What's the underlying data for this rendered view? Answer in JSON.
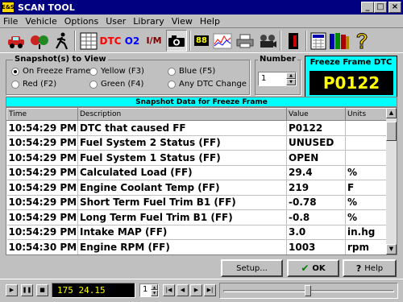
{
  "app": {
    "icon_text": "E&S",
    "title": "SCAN TOOL"
  },
  "window_buttons": {
    "minimize": "_",
    "maximize": "□",
    "close": "×"
  },
  "menu": [
    "File",
    "Vehicle",
    "Options",
    "User",
    "Library",
    "View",
    "Help"
  ],
  "toolbar": {
    "dtc": "DTC",
    "o2": "O2",
    "im": "I/M",
    "digital": "88"
  },
  "snapshot": {
    "label": "Snapshot(s) to View",
    "options": [
      "On Freeze Frame",
      "Yellow (F3)",
      "Blue (F5)",
      "Red (F2)",
      "Green (F4)",
      "Any DTC Change"
    ],
    "selected": "On Freeze Frame"
  },
  "number": {
    "label": "Number",
    "value": "1"
  },
  "freeze_frame_dtc": {
    "label": "Freeze Frame DTC",
    "value": "P0122"
  },
  "grid": {
    "caption": "Snapshot Data for Freeze Frame",
    "columns": [
      "Time",
      "Description",
      "Value",
      "Units"
    ],
    "rows": [
      [
        "10:54:29 PM",
        "DTC that caused  FF",
        "P0122",
        ""
      ],
      [
        "10:54:29 PM",
        "Fuel System 2 Status (FF)",
        "UNUSED",
        ""
      ],
      [
        "10:54:29 PM",
        "Fuel System 1 Status (FF)",
        "OPEN",
        ""
      ],
      [
        "10:54:29 PM",
        "Calculated Load (FF)",
        "29.4",
        "%"
      ],
      [
        "10:54:29 PM",
        "Engine Coolant Temp (FF)",
        "219",
        "F"
      ],
      [
        "10:54:29 PM",
        "Short Term Fuel Trim B1 (FF)",
        "-0.78",
        "%"
      ],
      [
        "10:54:29 PM",
        "Long Term Fuel Trim B1 (FF)",
        "-0.8",
        "%"
      ],
      [
        "10:54:29 PM",
        "Intake MAP (FF)",
        "3.0",
        "in.hg"
      ],
      [
        "10:54:30 PM",
        "Engine RPM (FF)",
        "1003",
        "rpm"
      ]
    ]
  },
  "buttons": {
    "setup": "Setup...",
    "ok": "OK",
    "help": "Help"
  },
  "status": {
    "readout": "175  24.15",
    "frame": "1"
  },
  "colors": {
    "titlebar": "#000080",
    "dtc_text": "#ff0000",
    "o2_text": "#0000ff",
    "cyan": "#00ffff",
    "display_text": "#ffff00"
  }
}
